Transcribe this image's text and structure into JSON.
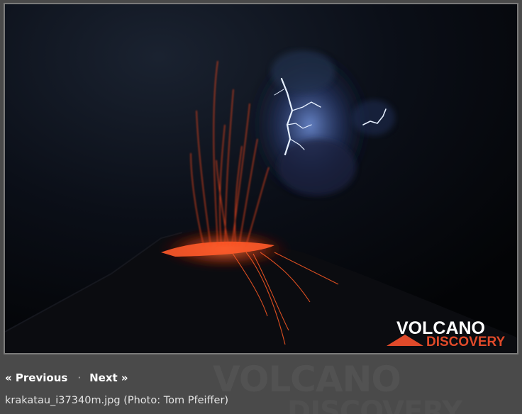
{
  "photo": {
    "watermark_line1": "VOLCANO",
    "watermark_line2": "DISCOVERY"
  },
  "background_watermark": {
    "line1": "VOLCANO",
    "line2": "DISCOVERY"
  },
  "pager": {
    "previous_label": "« Previous",
    "separator": "·",
    "next_label": "Next »"
  },
  "caption": "krakatau_i37340m.jpg (Photo: Tom Pfeiffer)",
  "colors": {
    "page_background": "#4a4a4a",
    "photo_border": "#7a7a7a",
    "watermark_accent": "#e04a2a",
    "caption_text": "#e4e4e4"
  }
}
